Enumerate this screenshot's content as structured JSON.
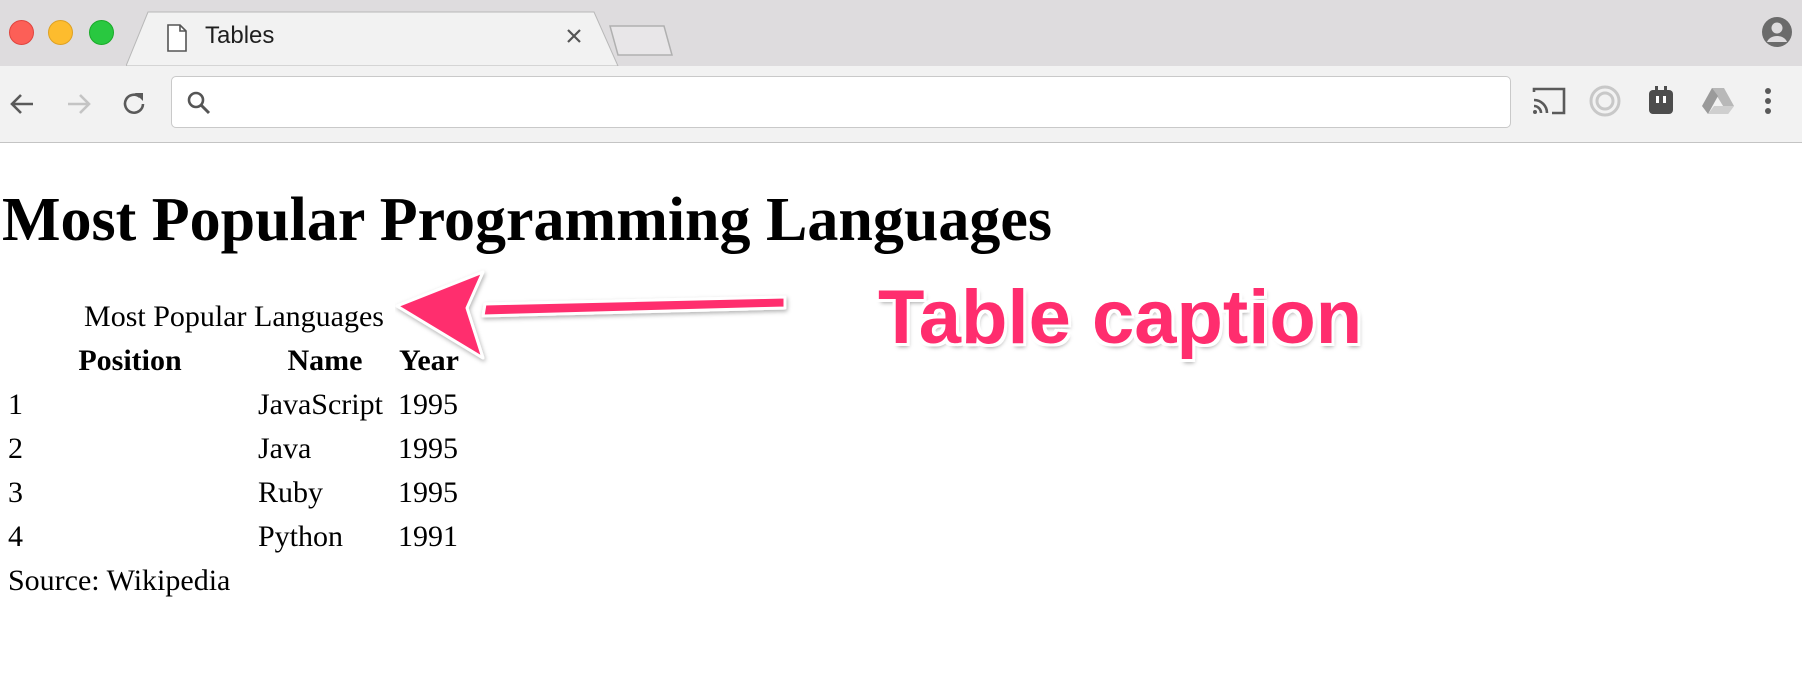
{
  "browser": {
    "tab": {
      "title": "Tables",
      "icon": "document-icon"
    },
    "omnibox": {
      "value": "",
      "placeholder": ""
    },
    "extensions": [
      "cast-icon",
      "circle-extension-icon",
      "plug-extension-icon",
      "drive-icon",
      "menu-icon"
    ]
  },
  "page": {
    "heading": "Most Popular Programming Languages",
    "table": {
      "caption": "Most Popular Languages",
      "headers": [
        "Position",
        "Name",
        "Year"
      ],
      "rows": [
        [
          "1",
          "JavaScript",
          "1995"
        ],
        [
          "2",
          "Java",
          "1995"
        ],
        [
          "3",
          "Ruby",
          "1995"
        ],
        [
          "4",
          "Python",
          "1991"
        ]
      ],
      "footer": "Source: Wikipedia"
    }
  },
  "annotation": {
    "label": "Table caption",
    "color": "#ff2d6e"
  }
}
